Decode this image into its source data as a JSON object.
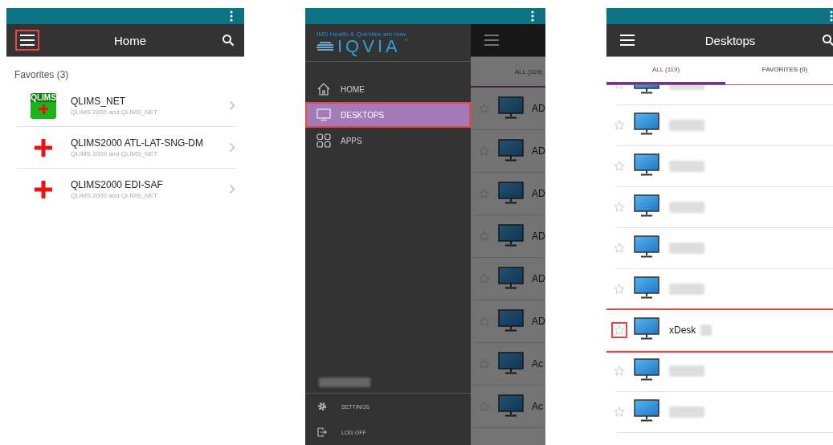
{
  "home_screen": {
    "title": "Home",
    "menu_highlighted": true,
    "section": "Favorites (3)",
    "items": [
      {
        "kind": "qlims",
        "icon_label": "QLIMS",
        "name": "QLIMS_NET",
        "subtitle": "QLIMS 2000 and QLIMS_NET"
      },
      {
        "kind": "cross",
        "name": "QLIMS2000 ATL-LAT-SNG-DM",
        "subtitle": "QLIMS 2000 and QLIMS_NET"
      },
      {
        "kind": "cross",
        "name": "QLIMS2000 EDI-SAF",
        "subtitle": "QLIMS 2000 and QLIMS_NET"
      }
    ]
  },
  "drawer_screen": {
    "logo_tagline": "IMS Health & Quintiles are now",
    "logo_text": "IQVIA",
    "logo_mark": "™",
    "menu": [
      {
        "kind": "home",
        "label": "HOME",
        "selected": false,
        "highlighted": false
      },
      {
        "kind": "desktops",
        "label": "DESKTOPS",
        "selected": true,
        "highlighted": true
      },
      {
        "kind": "apps",
        "label": "APPS",
        "selected": false,
        "highlighted": false
      }
    ],
    "user_redacted": true,
    "footer": [
      {
        "kind": "settings",
        "label": "SETTINGS"
      },
      {
        "kind": "logoff",
        "label": "LOG OFF"
      }
    ],
    "background_tab": "ALL (119)",
    "background_rows": [
      "AD",
      "AD",
      "AD",
      "AD",
      "AD",
      "AD",
      "Ac",
      "Ac"
    ]
  },
  "desktops_screen": {
    "title": "Desktops",
    "tabs": [
      {
        "label": "ALL (119)",
        "selected": true
      },
      {
        "label": "FAVORITES (0)",
        "selected": false
      }
    ],
    "rows": [
      {
        "redacted": true,
        "highlighted": false
      },
      {
        "redacted": true,
        "highlighted": false
      },
      {
        "redacted": true,
        "highlighted": false
      },
      {
        "redacted": true,
        "highlighted": false
      },
      {
        "redacted": true,
        "highlighted": false
      },
      {
        "redacted": true,
        "highlighted": false
      },
      {
        "name": "xDesk",
        "redacted": true,
        "highlighted": true
      },
      {
        "redacted": true,
        "highlighted": false
      },
      {
        "redacted": true,
        "highlighted": false
      }
    ]
  }
}
